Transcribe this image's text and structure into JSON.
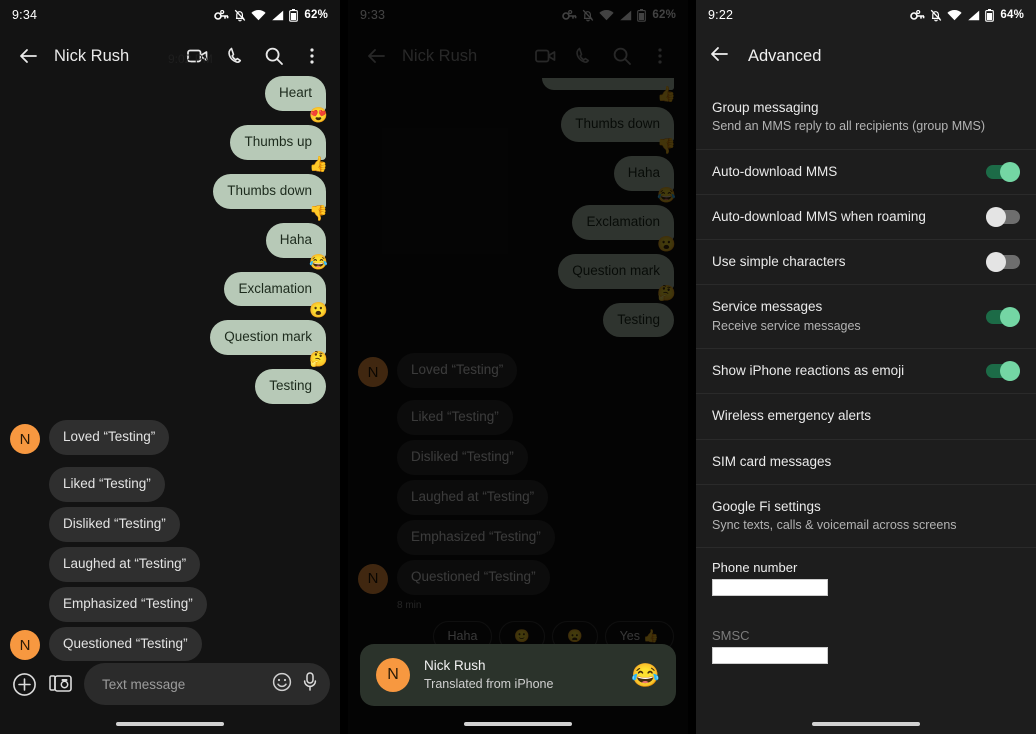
{
  "panels": [
    {
      "id": "conversation-current",
      "statusbar": {
        "time": "9:34",
        "battery_text": "62%",
        "icons": [
          "vpn-key-icon",
          "bell-muted-icon",
          "wifi-icon",
          "cellular-signal-icon",
          "battery-icon"
        ]
      },
      "appbar": {
        "title": "Nick Rush",
        "back_icon": "back-arrow-icon",
        "actions": [
          "video-call-icon",
          "phone-call-icon",
          "search-icon",
          "overflow-menu-icon"
        ]
      },
      "messages": [
        {
          "dir": "out",
          "text": "Heart",
          "reaction": "😍"
        },
        {
          "dir": "out",
          "text": "Thumbs up",
          "reaction": "👍"
        },
        {
          "dir": "out",
          "text": "Thumbs down",
          "reaction": "👎"
        },
        {
          "dir": "out",
          "text": "Haha",
          "reaction": "😂"
        },
        {
          "dir": "out",
          "text": "Exclamation",
          "reaction": "😮"
        },
        {
          "dir": "out",
          "text": "Question mark",
          "reaction": "🤔"
        },
        {
          "dir": "out",
          "text": "Testing",
          "reaction": ""
        },
        {
          "dir": "in",
          "text": "Loved “Testing”",
          "avatar": "N"
        },
        {
          "dir": "in",
          "text": "Liked “Testing”",
          "avatar": ""
        },
        {
          "dir": "in",
          "text": "Disliked “Testing”",
          "avatar": ""
        },
        {
          "dir": "in",
          "text": "Laughed at “Testing”",
          "avatar": ""
        },
        {
          "dir": "in",
          "text": "Emphasized “Testing”",
          "avatar": ""
        },
        {
          "dir": "in",
          "text": "Questioned “Testing”",
          "avatar": "N"
        }
      ],
      "compose": {
        "placeholder": "Text message",
        "plus_icon": "add-circle-icon",
        "gallery_icon": "gallery-camera-icon",
        "emoji_icon": "emoji-smiley-icon",
        "mic_icon": "microphone-icon"
      }
    },
    {
      "id": "conversation-dimmed",
      "statusbar": {
        "time": "9:33",
        "battery_text": "62%",
        "icons": [
          "vpn-key-icon",
          "bell-muted-icon",
          "wifi-icon",
          "cellular-signal-icon",
          "battery-icon"
        ]
      },
      "appbar": {
        "title": "Nick Rush",
        "back_icon": "back-arrow-icon",
        "actions": [
          "video-call-icon",
          "phone-call-icon",
          "search-icon",
          "overflow-menu-icon"
        ]
      },
      "partial_top_reaction": "👍",
      "messages": [
        {
          "dir": "out",
          "text": "Thumbs down",
          "reaction": "👎"
        },
        {
          "dir": "out",
          "text": "Haha",
          "reaction": "😂"
        },
        {
          "dir": "out",
          "text": "Exclamation",
          "reaction": "😮"
        },
        {
          "dir": "out",
          "text": "Question mark",
          "reaction": "🤔"
        },
        {
          "dir": "out",
          "text": "Testing",
          "reaction": ""
        },
        {
          "dir": "in",
          "text": "Loved “Testing”",
          "avatar": "N"
        },
        {
          "dir": "in",
          "text": "Liked “Testing”",
          "avatar": ""
        },
        {
          "dir": "in",
          "text": "Disliked “Testing”",
          "avatar": ""
        },
        {
          "dir": "in",
          "text": "Laughed at “Testing”",
          "avatar": ""
        },
        {
          "dir": "in",
          "text": "Emphasized “Testing”",
          "avatar": ""
        },
        {
          "dir": "in",
          "text": "Questioned “Testing”",
          "avatar": "N"
        }
      ],
      "timestamp": "8 min",
      "chips": [
        "Haha",
        "🙂",
        "😦",
        "Yes 👍"
      ],
      "toast": {
        "avatar": "N",
        "name": "Nick Rush",
        "subtitle": "Translated from iPhone",
        "emoji": "😂"
      }
    },
    {
      "id": "advanced-settings",
      "statusbar": {
        "time": "9:22",
        "battery_text": "64%",
        "icons": [
          "vpn-key-icon",
          "bell-muted-icon",
          "wifi-icon",
          "cellular-signal-icon",
          "battery-icon"
        ]
      },
      "appbar": {
        "title": "Advanced",
        "back_icon": "back-arrow-icon"
      },
      "settings": [
        {
          "title": "Group messaging",
          "sub": "Send an MMS reply to all recipients (group MMS)",
          "toggle": null
        },
        {
          "title": "Auto-download MMS",
          "sub": "",
          "toggle": "on"
        },
        {
          "title": "Auto-download MMS when roaming",
          "sub": "",
          "toggle": "off"
        },
        {
          "title": "Use simple characters",
          "sub": "",
          "toggle": "off"
        },
        {
          "title": "Service messages",
          "sub": "Receive service messages",
          "toggle": "on"
        },
        {
          "title": "Show iPhone reactions as emoji",
          "sub": "",
          "toggle": "on"
        },
        {
          "title": "Wireless emergency alerts",
          "sub": "",
          "toggle": null
        },
        {
          "title": "SIM card messages",
          "sub": "",
          "toggle": null
        },
        {
          "title": "Google Fi settings",
          "sub": "Sync texts, calls & voicemail across screens",
          "toggle": null
        }
      ],
      "fields": [
        {
          "label": "Phone number",
          "value": "",
          "redacted": true,
          "dim": false
        },
        {
          "label": "SMSC",
          "value": "",
          "redacted": true,
          "dim": true
        }
      ]
    }
  ],
  "colors": {
    "sent_bubble": "#b7c9b7",
    "received_bubble": "#2f2f2f",
    "avatar": "#f79840",
    "toggle_on": "#74d6a4",
    "toggle_off": "#e4e4e4",
    "toast_bg": "#2b332b",
    "panel_bg": "#131313",
    "settings_bg": "#1d1d1d"
  }
}
